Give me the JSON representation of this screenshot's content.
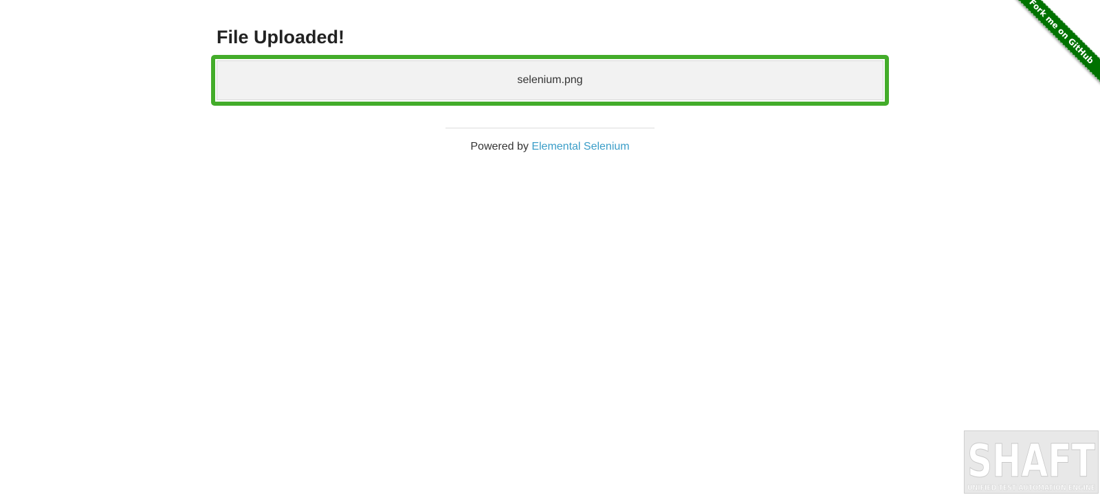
{
  "page": {
    "title": "File Uploaded!",
    "uploaded_files": "selenium.png"
  },
  "footer": {
    "powered_by_text": "Powered by ",
    "link_text": "Elemental Selenium"
  },
  "ribbon": {
    "label": "Fork me on GitHub",
    "color": "#007200"
  },
  "watermark": {
    "logo_text": "SHAFT",
    "tagline": "UNIFIED TEST AUTOMATION ENGINE"
  },
  "colors": {
    "success_border": "#43ac2a",
    "link": "#3a9dc8",
    "panel_bg": "#f2f2f2"
  }
}
